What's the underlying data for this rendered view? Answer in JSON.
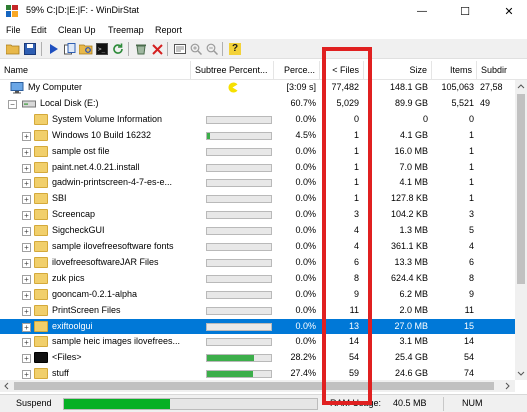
{
  "window": {
    "title": "59% C:|D:|E:|F: - WinDirStat",
    "controls": {
      "minimize": "—",
      "maximize": "☐",
      "close": "✕"
    }
  },
  "menu": [
    "File",
    "Edit",
    "Clean Up",
    "Treemap",
    "Report"
  ],
  "toolbar": {
    "icons": [
      "open-icon",
      "save-icon",
      "play-icon",
      "copy-path-icon",
      "explorer-icon",
      "cmd-icon",
      "refresh-icon",
      "recycle-icon",
      "delete-icon",
      "properties-icon",
      "zoom-in-icon",
      "zoom-out-icon",
      "help-icon"
    ]
  },
  "columns": {
    "name": "Name",
    "subtree": "Subtree Percent...",
    "percent": "Perce...",
    "files": "< Files",
    "size": "Size",
    "items": "Items",
    "subdirs": "Subdir"
  },
  "rows": [
    {
      "name": "My Computer",
      "subtree": "[3:09 s]",
      "percent": "",
      "files": "77,482",
      "size": "148.1 GB",
      "items": "105,063",
      "subdirs": "27,58",
      "icon": "computer",
      "expander": "",
      "indent": 0,
      "bar": null,
      "pacman": true
    },
    {
      "name": "Local Disk (E:)",
      "subtree": "",
      "percent": "60.7%",
      "files": "5,029",
      "size": "89.9 GB",
      "items": "5,521",
      "subdirs": "49",
      "icon": "drive",
      "expander": "−",
      "indent": 1,
      "bar": null
    },
    {
      "name": "System Volume Information",
      "subtree": "",
      "percent": "0.0%",
      "files": "0",
      "size": "0",
      "items": "0",
      "subdirs": "",
      "icon": "folder",
      "expander": "",
      "indent": 2,
      "bar": 0
    },
    {
      "name": "Windows 10 Build 16232",
      "subtree": "",
      "percent": "4.5%",
      "files": "1",
      "size": "4.1 GB",
      "items": "1",
      "subdirs": "",
      "icon": "folder",
      "expander": "+",
      "indent": 2,
      "bar": 0.045
    },
    {
      "name": "sample ost file",
      "subtree": "",
      "percent": "0.0%",
      "files": "1",
      "size": "16.0 MB",
      "items": "1",
      "subdirs": "",
      "icon": "folder",
      "expander": "+",
      "indent": 2,
      "bar": 0
    },
    {
      "name": "paint.net.4.0.21.install",
      "subtree": "",
      "percent": "0.0%",
      "files": "1",
      "size": "7.0 MB",
      "items": "1",
      "subdirs": "",
      "icon": "folder",
      "expander": "+",
      "indent": 2,
      "bar": 0
    },
    {
      "name": "gadwin-printscreen-4-7-es-e...",
      "subtree": "",
      "percent": "0.0%",
      "files": "1",
      "size": "4.1 MB",
      "items": "1",
      "subdirs": "",
      "icon": "folder",
      "expander": "+",
      "indent": 2,
      "bar": 0
    },
    {
      "name": "SBI",
      "subtree": "",
      "percent": "0.0%",
      "files": "1",
      "size": "127.8 KB",
      "items": "1",
      "subdirs": "",
      "icon": "folder",
      "expander": "+",
      "indent": 2,
      "bar": 0
    },
    {
      "name": "Screencap",
      "subtree": "",
      "percent": "0.0%",
      "files": "3",
      "size": "104.2 KB",
      "items": "3",
      "subdirs": "",
      "icon": "folder",
      "expander": "+",
      "indent": 2,
      "bar": 0
    },
    {
      "name": "SigcheckGUI",
      "subtree": "",
      "percent": "0.0%",
      "files": "4",
      "size": "1.3 MB",
      "items": "5",
      "subdirs": "",
      "icon": "folder",
      "expander": "+",
      "indent": 2,
      "bar": 0
    },
    {
      "name": "sample ilovefreesoftware fonts",
      "subtree": "",
      "percent": "0.0%",
      "files": "4",
      "size": "361.1 KB",
      "items": "4",
      "subdirs": "",
      "icon": "folder",
      "expander": "+",
      "indent": 2,
      "bar": 0
    },
    {
      "name": "ilovefreesoftwareJAR Files",
      "subtree": "",
      "percent": "0.0%",
      "files": "6",
      "size": "13.3 MB",
      "items": "6",
      "subdirs": "",
      "icon": "folder",
      "expander": "+",
      "indent": 2,
      "bar": 0
    },
    {
      "name": "zuk pics",
      "subtree": "",
      "percent": "0.0%",
      "files": "8",
      "size": "624.4 KB",
      "items": "8",
      "subdirs": "",
      "icon": "folder",
      "expander": "+",
      "indent": 2,
      "bar": 0
    },
    {
      "name": "gooncam-0.2.1-alpha",
      "subtree": "",
      "percent": "0.0%",
      "files": "9",
      "size": "6.2 MB",
      "items": "9",
      "subdirs": "",
      "icon": "folder",
      "expander": "+",
      "indent": 2,
      "bar": 0
    },
    {
      "name": "PrintScreen Files",
      "subtree": "",
      "percent": "0.0%",
      "files": "11",
      "size": "2.0 MB",
      "items": "11",
      "subdirs": "",
      "icon": "folder",
      "expander": "+",
      "indent": 2,
      "bar": 0
    },
    {
      "name": "exiftoolgui",
      "subtree": "",
      "percent": "0.0%",
      "files": "13",
      "size": "27.0 MB",
      "items": "15",
      "subdirs": "",
      "icon": "folder",
      "expander": "+",
      "indent": 2,
      "bar": 0,
      "selected": true
    },
    {
      "name": "sample heic images ilovefrees...",
      "subtree": "",
      "percent": "0.0%",
      "files": "14",
      "size": "3.1 MB",
      "items": "14",
      "subdirs": "",
      "icon": "folder",
      "expander": "+",
      "indent": 2,
      "bar": 0
    },
    {
      "name": "<Files>",
      "subtree": "",
      "percent": "28.2%",
      "files": "54",
      "size": "25.4 GB",
      "items": "54",
      "subdirs": "",
      "icon": "files",
      "expander": "+",
      "indent": 2,
      "bar": 0.282
    },
    {
      "name": "stuff",
      "subtree": "",
      "percent": "27.4%",
      "files": "59",
      "size": "24.6 GB",
      "items": "74",
      "subdirs": "",
      "icon": "folder",
      "expander": "+",
      "indent": 2,
      "bar": 0.274
    }
  ],
  "status": {
    "suspend": "Suspend",
    "progress": 0.42,
    "ram_label": "RAM Usage:",
    "ram_value": "40.5 MB",
    "num": "NUM"
  },
  "colors": {
    "selection": "#0078d7",
    "bar_fill": "#3cae4a",
    "folder": "#f1cf6b",
    "highlight": "#e02020"
  }
}
